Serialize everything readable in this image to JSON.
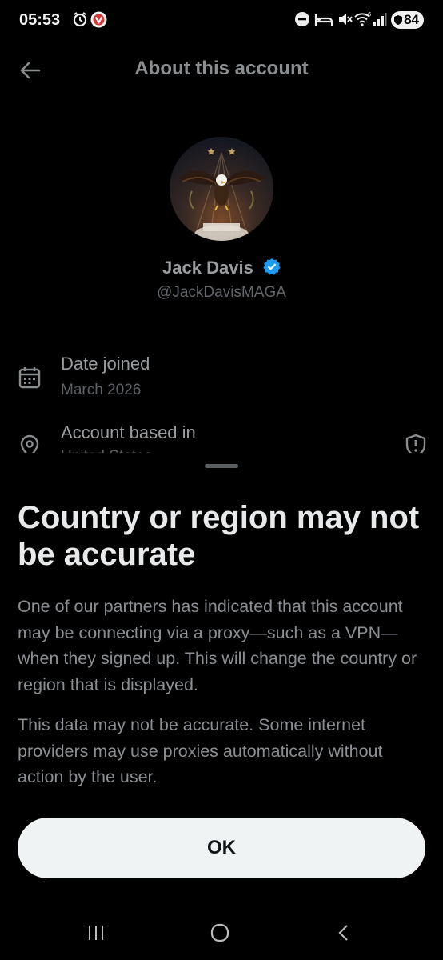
{
  "status_bar": {
    "time": "05:53",
    "battery": "84",
    "icons": [
      "alarm-icon",
      "vivaldi-icon",
      "dnd-icon",
      "sleep-icon",
      "mute-icon",
      "wifi-6-icon",
      "signal-icon",
      "battery-icon"
    ]
  },
  "header": {
    "title": "About this account",
    "back_icon": "back-arrow-icon"
  },
  "profile": {
    "name": "Jack Davis",
    "handle": "@JackDavisMAGA",
    "verified": true,
    "avatar": "eagle-avatar"
  },
  "details": {
    "date_joined_label": "Date joined",
    "date_joined_value": "March 2026",
    "based_in_label": "Account based in",
    "based_in_value": "United States"
  },
  "sheet": {
    "title": "Country or region may not be accurate",
    "paragraph1": "One of our partners has indicated that this account may be connecting via a proxy—such as a VPN—when they signed up. This will change the country or region that is displayed.",
    "paragraph2": "This data may not be accurate. Some internet providers may use proxies automatically without action by the user.",
    "ok_label": "OK"
  },
  "colors": {
    "background": "#000000",
    "verified_blue": "#1d9bf0",
    "button_bg": "#eff3f4"
  }
}
